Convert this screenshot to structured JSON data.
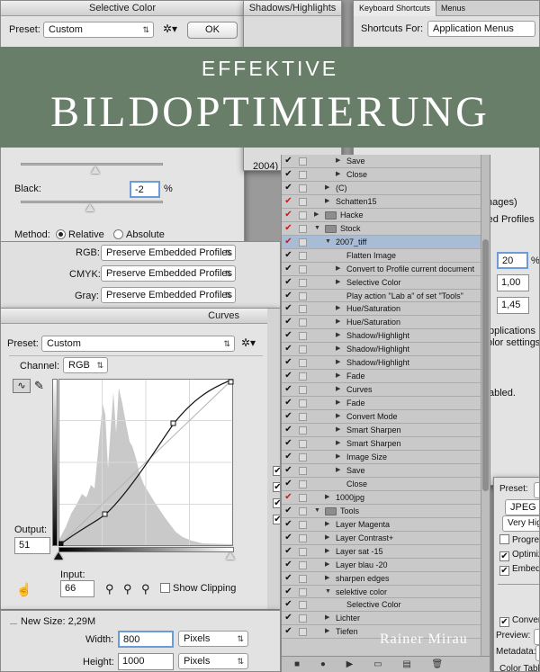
{
  "banner": {
    "line1": "EFFEKTIVE",
    "line2": "BILDOPTIMIERUNG",
    "author": "Rainer Mirau"
  },
  "selective_color": {
    "title": "Selective Color",
    "preset_label": "Preset:",
    "preset_value": "Custom",
    "ok_label": "OK",
    "black_label": "Black:",
    "black_value": "-2",
    "percent": "%",
    "method_label": "Method:",
    "relative_label": "Relative",
    "absolute_label": "Absolute",
    "black_level": 0.49
  },
  "shadows_highlights": {
    "title": "Shadows/Highlights"
  },
  "keyboard_shortcuts": {
    "tab1": "Keyboard Shortcuts",
    "tab2": "Menus",
    "shortcuts_for_label": "Shortcuts For:",
    "shortcuts_for_value": "Application Menus",
    "frag_images": "nages)",
    "frag_profiles": "red Profiles",
    "value1": "20",
    "value2": "1,00",
    "value3": "1,45",
    "frag_applications": "pplications",
    "frag_settings": "olor settings",
    "frag_enabled": "abled.",
    "frag_year": "2004)"
  },
  "color_settings": {
    "rgb_label": "RGB:",
    "rgb_value": "Preserve Embedded Profiles",
    "cmyk_label": "CMYK:",
    "cmyk_value": "Preserve Embedded Profiles",
    "gray_label": "Gray:",
    "gray_value": "Preserve Embedded Profiles"
  },
  "curves": {
    "title": "Curves",
    "preset_label": "Preset:",
    "preset_value": "Custom",
    "channel_label": "Channel:",
    "channel_value": "RGB",
    "output_label": "Output:",
    "output_value": "51",
    "input_label": "Input:",
    "input_value": "66",
    "show_clipping_label": "Show Clipping"
  },
  "image_size": {
    "new_size_label": "New Size: 2,29M",
    "width_label": "Width:",
    "width_value": "800",
    "width_unit": "Pixels",
    "height_label": "Height:",
    "height_value": "1000",
    "height_unit": "Pixels"
  },
  "save_for_web": {
    "preset_label": "Preset:",
    "preset_value": "[",
    "format_value": "JPEG",
    "quality_value": "Very High",
    "progressive_label": "Progress",
    "optimized_label": "Optimiz",
    "embed_label": "Embed C",
    "convert_label": "Convert",
    "preview_label": "Preview:",
    "preview_value": "M",
    "metadata_label": "Metadata:",
    "metadata_value": "",
    "color_table_label": "Color Table"
  },
  "actions": {
    "rows": [
      {
        "indent": 2,
        "check": "",
        "label": "Save"
      },
      {
        "indent": 2,
        "check": "",
        "label": "Close"
      },
      {
        "indent": 1,
        "check": "",
        "label": "(C)",
        "folder": false
      },
      {
        "indent": 1,
        "check": "red",
        "label": "Schatten15"
      },
      {
        "indent": 0,
        "check": "red",
        "label": "Hacke",
        "folder": true,
        "open": false
      },
      {
        "indent": 0,
        "check": "red",
        "label": "Stock",
        "folder": true,
        "open": true
      },
      {
        "indent": 1,
        "check": "red",
        "label": "2007_tiff",
        "open": true,
        "selected": true
      },
      {
        "indent": 2,
        "check": "",
        "label": "Flatten Image",
        "notri": true
      },
      {
        "indent": 2,
        "check": "",
        "label": "Convert to Profile current document"
      },
      {
        "indent": 2,
        "check": "",
        "label": "Selective Color"
      },
      {
        "indent": 2,
        "check": "",
        "label": "Play action \"Lab a\" of set \"Tools\"",
        "notri": true
      },
      {
        "indent": 2,
        "check": "",
        "label": "Hue/Saturation"
      },
      {
        "indent": 2,
        "check": "",
        "label": "Hue/Saturation"
      },
      {
        "indent": 2,
        "check": "",
        "label": "Shadow/Highlight"
      },
      {
        "indent": 2,
        "check": "",
        "label": "Shadow/Highlight"
      },
      {
        "indent": 2,
        "check": "",
        "label": "Shadow/Highlight"
      },
      {
        "indent": 2,
        "check": "",
        "label": "Fade"
      },
      {
        "indent": 2,
        "check": "",
        "label": "Curves"
      },
      {
        "indent": 2,
        "check": "",
        "label": "Fade"
      },
      {
        "indent": 2,
        "check": "",
        "label": "Convert Mode"
      },
      {
        "indent": 2,
        "check": "",
        "label": "Smart Sharpen"
      },
      {
        "indent": 2,
        "check": "",
        "label": "Smart Sharpen"
      },
      {
        "indent": 2,
        "check": "",
        "label": "Image Size"
      },
      {
        "indent": 2,
        "check": "",
        "label": "Save"
      },
      {
        "indent": 2,
        "check": "",
        "label": "Close",
        "notri": true
      },
      {
        "indent": 1,
        "check": "red",
        "label": "1000jpg"
      },
      {
        "indent": 0,
        "check": "",
        "label": "Tools",
        "folder": true,
        "open": true
      },
      {
        "indent": 1,
        "check": "",
        "label": "Layer Magenta"
      },
      {
        "indent": 1,
        "check": "",
        "label": "Layer Contrast+"
      },
      {
        "indent": 1,
        "check": "",
        "label": "Layer sat -15"
      },
      {
        "indent": 1,
        "check": "",
        "label": "Layer blau -20"
      },
      {
        "indent": 1,
        "check": "",
        "label": "sharpen edges"
      },
      {
        "indent": 1,
        "check": "",
        "label": "selektive color",
        "open": true
      },
      {
        "indent": 2,
        "check": "",
        "label": "Selective Color",
        "notri": true
      },
      {
        "indent": 1,
        "check": "",
        "label": "Lichter"
      },
      {
        "indent": 1,
        "check": "",
        "label": "Tiefen"
      }
    ],
    "footer_icons": "■ ● ▶ ▭ ▤ 🗑"
  }
}
